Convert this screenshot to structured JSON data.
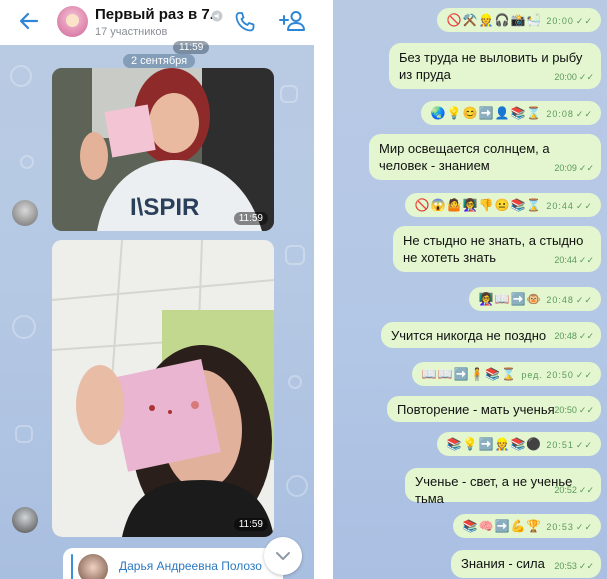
{
  "left": {
    "group_title": "Первый раз в 7...",
    "group_subtitle": "17 участников",
    "time_pill_top": "11:59",
    "date_pill": "2 сентября",
    "photo1_time": "11:59",
    "photo2_time": "11:59",
    "reply_name": "Дарья Андреевна Полозо",
    "icons": [
      "back-arrow-icon",
      "mute-icon",
      "call-icon",
      "add-user-icon",
      "chevron-down-icon"
    ]
  },
  "right": {
    "messages": [
      {
        "text": "🚫⚒️👷🎧📸🛀",
        "time": "20:00",
        "emoji": true
      },
      {
        "text": "Без труда не выловить и рыбу из пруда",
        "time": "20:00",
        "emoji": false
      },
      {
        "text": "🌏💡😊➡️👤📚⌛",
        "time": "20:08",
        "emoji": true
      },
      {
        "text": "Мир освещается солнцем, а человек - знанием",
        "time": "20:09",
        "emoji": false
      },
      {
        "text": "🚫😱🤷👩‍🏫👎😐📚⌛",
        "time": "20:44",
        "emoji": true
      },
      {
        "text": "Не стыдно не знать, а стыдно не хотеть знать",
        "time": "20:44",
        "emoji": false
      },
      {
        "text": "👩‍🏫📖➡️🐵",
        "time": "20:48",
        "emoji": true
      },
      {
        "text": "Учится никогда не поздно",
        "time": "20:48",
        "emoji": false
      },
      {
        "text": "📖📖➡️🧍📚⌛",
        "time": "ред. 20:50",
        "emoji": true
      },
      {
        "text": "Повторение - мать ученья",
        "time": "20:50",
        "emoji": false
      },
      {
        "text": "📚💡➡️👷📚⚫",
        "time": "20:51",
        "emoji": true
      },
      {
        "text": "Ученье - свет, а не ученье тьма",
        "time": "20:52",
        "emoji": false
      },
      {
        "text": "📚🧠➡️💪🏆",
        "time": "20:53",
        "emoji": true
      },
      {
        "text": "Знания - сила",
        "time": "20:53",
        "emoji": false
      }
    ]
  }
}
